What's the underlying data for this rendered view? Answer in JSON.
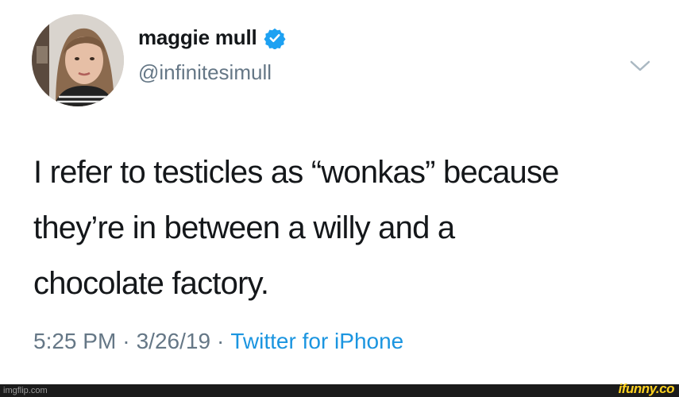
{
  "tweet": {
    "display_name": "maggie mull",
    "handle": "@infinitesimull",
    "verified": true,
    "text_lines": [
      "I refer to testicles as “wonkas” because",
      "they’re in between a willy and a",
      "chocolate factory."
    ],
    "time": "5:25 PM",
    "date": "3/26/19",
    "separator": "·",
    "source": "Twitter for iPhone"
  },
  "watermarks": {
    "imgflip": "imgflip.com",
    "ifunny": "ifunny.co"
  },
  "colors": {
    "text": "#14171a",
    "secondary": "#657786",
    "link": "#1b95e0",
    "verified": "#1da1f2",
    "ifunny": "#ffd21f"
  },
  "icons": {
    "verified": "verified-badge-icon",
    "menu": "chevron-down-icon"
  }
}
